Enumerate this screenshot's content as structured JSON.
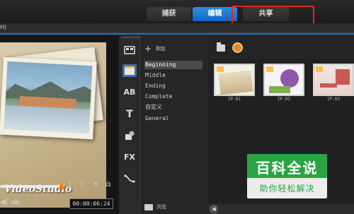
{
  "tabs": [
    {
      "label": "捕获"
    },
    {
      "label": "编辑"
    },
    {
      "label": "共享"
    }
  ],
  "menubar": {
    "help_label": "H)"
  },
  "preview": {
    "title_text": "VideoStudio",
    "hd_label": "HD",
    "timecode": "00:00:06:24"
  },
  "iconbar": {
    "items": [
      {
        "icon": "media-icon"
      },
      {
        "icon": "instant-project-icon",
        "active": true
      },
      {
        "icon": "transition-icon",
        "text": "AB"
      },
      {
        "icon": "title-icon",
        "text": "T"
      },
      {
        "icon": "graphics-icon"
      },
      {
        "icon": "fx-icon",
        "text": "FX"
      },
      {
        "icon": "path-icon"
      }
    ]
  },
  "listpanel": {
    "add_label": "添加",
    "categories": [
      "Beginning",
      "Middle",
      "Ending",
      "Complete",
      "自定义",
      "General"
    ],
    "selected_index": 0,
    "browse_label": "浏览"
  },
  "library": {
    "thumbnails": [
      {
        "caption": "IP-01"
      },
      {
        "caption": "IP-02"
      },
      {
        "caption": "IP-03"
      }
    ]
  },
  "watermark": {
    "title": "百科全说",
    "subtitle": "助你轻松解决"
  },
  "colors": {
    "accent": "#1f6fc4",
    "highlight": "#e1261c",
    "watermark_green": "#2aa444",
    "scrub_knob": "#ff7a00"
  }
}
